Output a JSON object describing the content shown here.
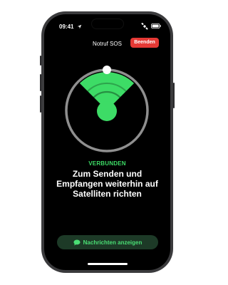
{
  "status_bar": {
    "time": "09:41"
  },
  "header": {
    "title": "Notruf SOS",
    "end_label": "Beenden"
  },
  "main": {
    "status": "VERBUNDEN",
    "instruction": "Zum Senden und Empfangen weiterhin auf Satelliten richten"
  },
  "footer": {
    "messages_button": "Nachrichten anzeigen"
  },
  "colors": {
    "accent": "#3ddc66",
    "danger": "#e53935",
    "background": "#000000"
  },
  "icons": {
    "location": "location-arrow-icon",
    "satellite": "satellite-icon",
    "battery": "battery-icon",
    "message": "message-bubble-icon"
  }
}
